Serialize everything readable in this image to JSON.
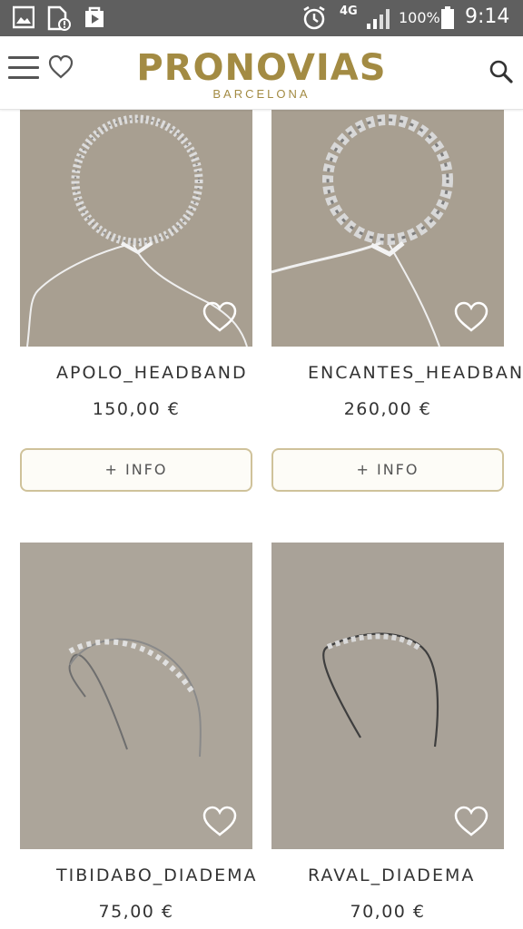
{
  "status_bar": {
    "network": "4G",
    "battery": "100%",
    "time": "9:14",
    "icons": [
      "gallery-icon",
      "sim-icon",
      "play-store-icon",
      "alarm-icon",
      "signal-icon",
      "battery-icon"
    ]
  },
  "header": {
    "brand": "PRONOVIAS",
    "subbrand": "BARCELONA",
    "brand_color": "#a38b43",
    "icons": [
      "menu-icon",
      "heart-icon",
      "search-icon"
    ]
  },
  "products": [
    {
      "name": "APOLO_HEADBAND",
      "price": "150,00 €",
      "button": "+ INFO"
    },
    {
      "name": "ENCANTES_HEADBAN",
      "price": "260,00 €",
      "button": "+ INFO"
    },
    {
      "name": "TIBIDABO_DIADEMA",
      "price": "75,00 €"
    },
    {
      "name": "RAVAL_DIADEMA",
      "price": "70,00 €"
    }
  ]
}
